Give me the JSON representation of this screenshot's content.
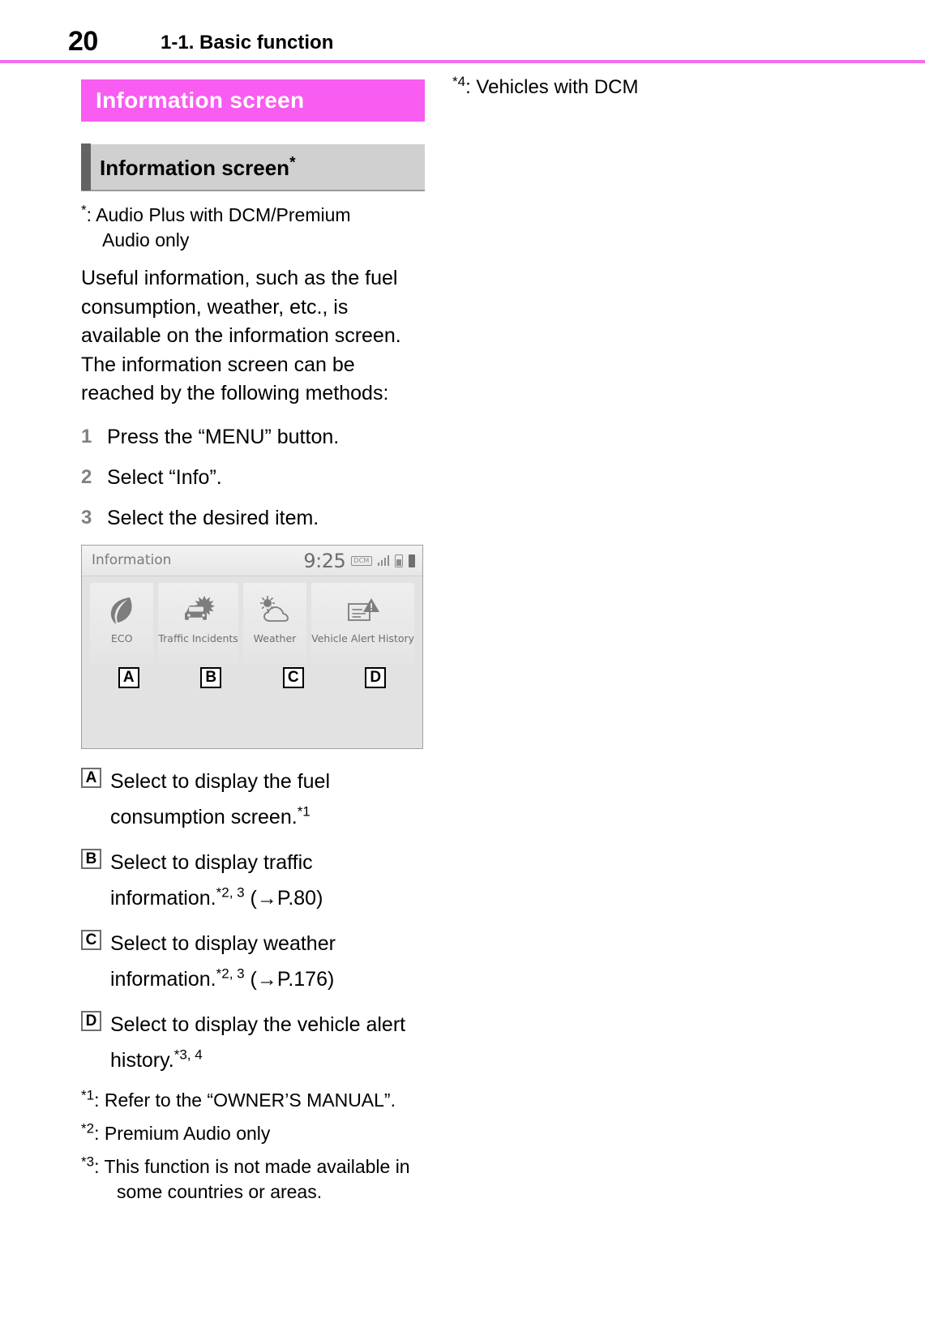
{
  "header": {
    "page_number": "20",
    "title": "1-1. Basic function",
    "rule_color": "#f36ef0"
  },
  "section": {
    "banner_title": "Information screen",
    "banner_color": "#f85cf0",
    "subsection_title": "Information screen",
    "subsection_marker": "*",
    "subsection_bg": "#d0d0d0"
  },
  "note": {
    "marker": "*",
    "line1": ": Audio Plus with DCM/Premium",
    "line2": "Audio only"
  },
  "intro": {
    "paragraph1": "Useful information, such as the fuel consumption, weather, etc., is available on the information screen.",
    "paragraph2": "The information screen can be reached by the following methods:"
  },
  "steps": [
    {
      "num": "1",
      "text": "Press the “MENU” button."
    },
    {
      "num": "2",
      "text": "Select “Info”."
    },
    {
      "num": "3",
      "text": "Select the desired item."
    }
  ],
  "device": {
    "title": "Information",
    "clock": "9:25",
    "dcm_badge": "DCM",
    "status_icons": [
      "dcm-badge-icon",
      "signal-bars-icon",
      "phone-icon",
      "battery-icon"
    ],
    "tiles": [
      {
        "label": "ECO",
        "icon": "leaf-icon",
        "callout": "A"
      },
      {
        "label": "Traffic Incidents",
        "icon": "traffic-incident-icon",
        "callout": "B"
      },
      {
        "label": "Weather",
        "icon": "sun-cloud-icon",
        "callout": "C"
      },
      {
        "label": "Vehicle Alert History",
        "icon": "alert-document-icon",
        "callout": "D"
      }
    ]
  },
  "descriptions": [
    {
      "marker": "A",
      "text": "Select to display the fuel consumption screen.",
      "sup": "*1",
      "ref": ""
    },
    {
      "marker": "B",
      "text": "Select to display traffic information.",
      "sup": "*2, 3",
      "ref": " (→P.80)"
    },
    {
      "marker": "C",
      "text": "Select to display weather information.",
      "sup": "*2, 3",
      "ref": " (→P.176)"
    },
    {
      "marker": "D",
      "text": "Select to display the vehicle alert history.",
      "sup": "*3, 4",
      "ref": ""
    }
  ],
  "footnotes": [
    {
      "marker": "*1",
      "text": ": Refer to the “OWNER’S MANUAL”."
    },
    {
      "marker": "*2",
      "text": ": Premium Audio only"
    },
    {
      "marker": "*3",
      "text": ": This function is not made available in some countries or areas."
    }
  ],
  "right_column": {
    "footnote_marker": "*4",
    "footnote_text": ": Vehicles with DCM"
  }
}
